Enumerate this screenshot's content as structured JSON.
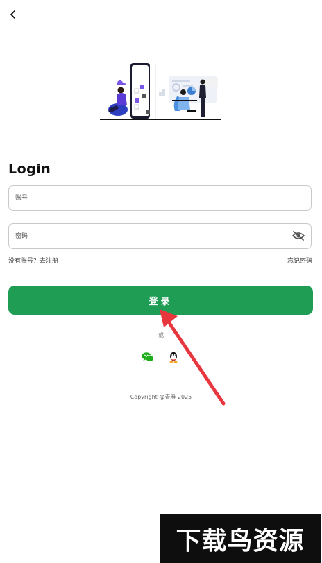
{
  "header": {
    "back_icon": "chevron-left-icon"
  },
  "form": {
    "title": "Login",
    "account": {
      "placeholder": "账号",
      "value": ""
    },
    "password": {
      "placeholder": "密码",
      "value": "",
      "toggle_icon": "eye-off-icon"
    },
    "register_link": "没有账号？去注册",
    "forgot_link": "忘记密码",
    "login_button": "登录"
  },
  "divider": {
    "or_label": "或"
  },
  "social": [
    {
      "name": "wechat",
      "icon": "wechat-icon",
      "color": "#1aad19"
    },
    {
      "name": "qq",
      "icon": "qq-icon",
      "color": "#111111"
    }
  ],
  "footer": {
    "copyright": "Copyright @青雅  2025"
  },
  "overlay": {
    "watermark": "下载鸟资源"
  },
  "colors": {
    "primary": "#1f9d55",
    "accent_purple": "#7b57e6",
    "arrow_red": "#e8363f"
  }
}
